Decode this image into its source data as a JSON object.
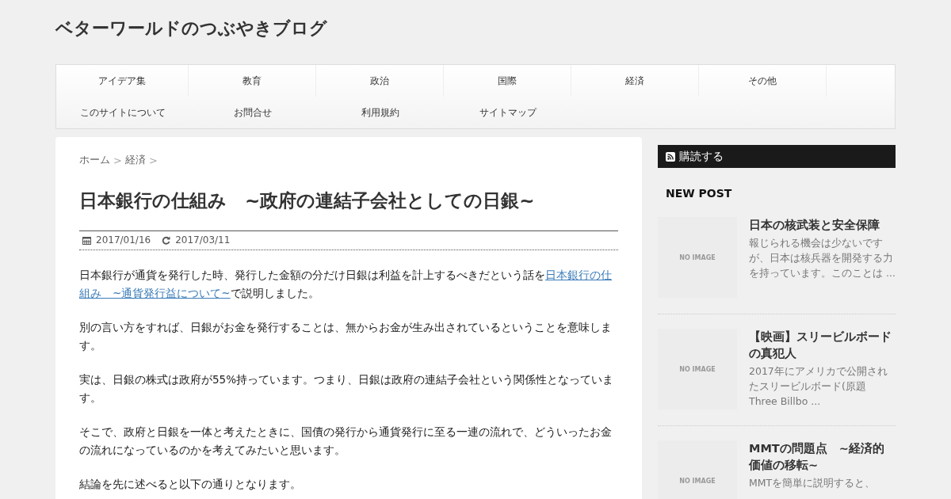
{
  "site_title": "ベターワールドのつぶやきブログ",
  "menu": [
    {
      "label": "アイデア集"
    },
    {
      "label": "教育"
    },
    {
      "label": "政治"
    },
    {
      "label": "国際"
    },
    {
      "label": "経済"
    },
    {
      "label": "その他"
    },
    {
      "label": "このサイトについて"
    },
    {
      "label": "お問合せ"
    },
    {
      "label": "利用規約"
    },
    {
      "label": "サイトマップ"
    }
  ],
  "breadcrumb": [
    {
      "label": "ホーム",
      "separator": ">"
    },
    {
      "label": "経済",
      "separator": ">"
    }
  ],
  "article": {
    "title": "日本銀行の仕組み　~政府の連結子会社としての日銀~",
    "published": "2017/01/16",
    "updated": "2017/03/11",
    "paragraphs": [
      {
        "before": "日本銀行が通貨を発行した時、発行した金額の分だけ日銀は利益を計上するべきだという話を",
        "link": [
          "日本銀行の仕",
          "組み　~通貨発行益について~"
        ],
        "after": "で説明しました。"
      },
      {
        "text": "別の言い方をすれば、日銀がお金を発行することは、無からお金が生み出されているということを意味します。"
      },
      {
        "text": "実は、日銀の株式は政府が55%持っています。つまり、日銀は政府の連結子会社という関係性となっています。"
      },
      {
        "text": "そこで、政府と日銀を一体と考えたときに、国債の発行から通貨発行に至る一連の流れで、どういったお金の流れになっているのかを考えてみたいと思います。"
      },
      {
        "text": "結論を先に述べると以下の通りとなります。"
      }
    ]
  },
  "sidebar": {
    "subscribe": "購読する",
    "new_post_heading": "NEW POST",
    "posts": [
      {
        "thumb": "NO IMAGE",
        "title": "日本の核武装と安全保障",
        "excerpt": "報じられる機会は少ないですが、日本は核兵器を開発する力を持っています。このことは ..."
      },
      {
        "thumb": "NO IMAGE",
        "title": "【映画】スリービルボードの真犯人",
        "excerpt": "2017年にアメリカで公開されたスリービルボード(原題 Three Billbo ..."
      },
      {
        "thumb": "NO IMAGE",
        "title": "MMTの問題点　~経済的価値の移転~",
        "excerpt": "MMTを簡単に説明すると、"
      }
    ]
  }
}
